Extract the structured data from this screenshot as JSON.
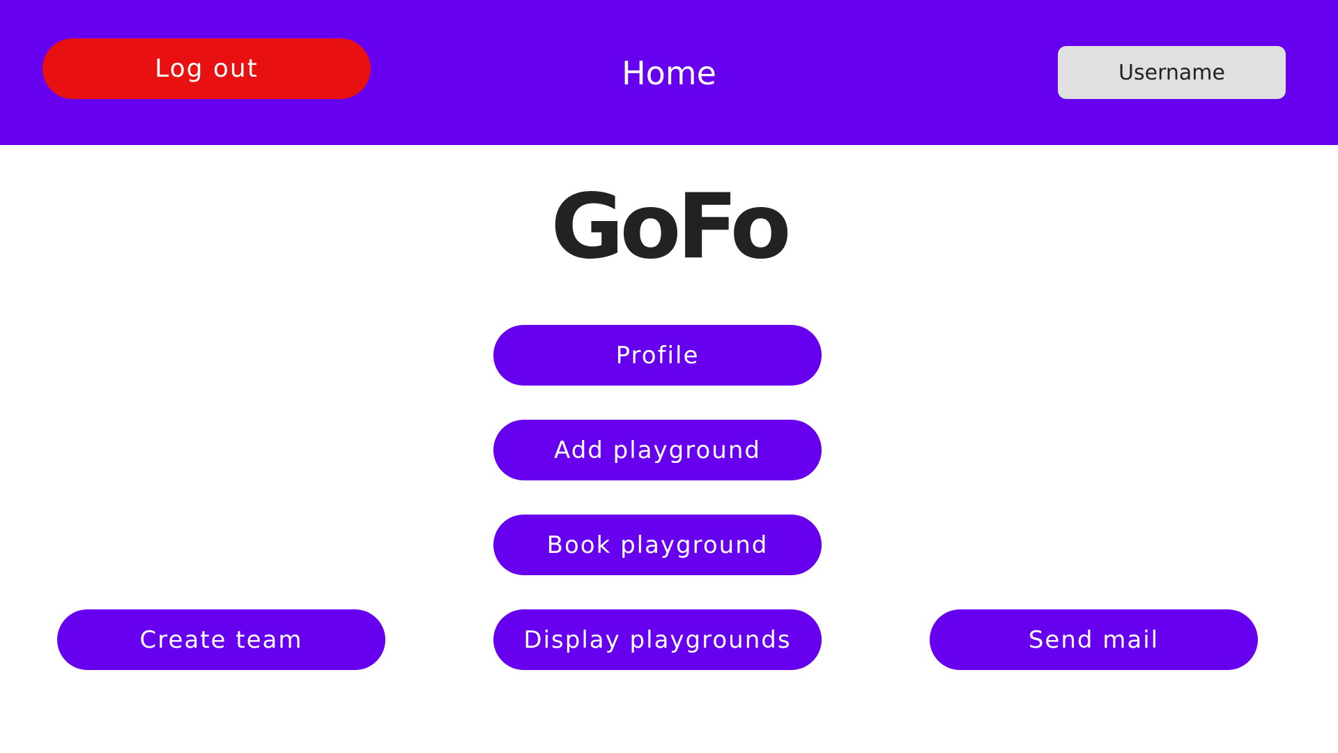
{
  "header": {
    "logout_label": "Log out",
    "title": "Home",
    "username_label": "Username"
  },
  "logo": {
    "text": "GoFo"
  },
  "menu": {
    "profile": "Profile",
    "add_playground": "Add playground",
    "book_playground": "Book playground",
    "display_playgrounds": "Display playgrounds",
    "create_team": "Create team",
    "send_mail": "Send mail"
  },
  "colors": {
    "primary": "#6600ee",
    "danger": "#e81010",
    "neutral_button": "#e0e0e0",
    "logo_text": "#222222"
  }
}
